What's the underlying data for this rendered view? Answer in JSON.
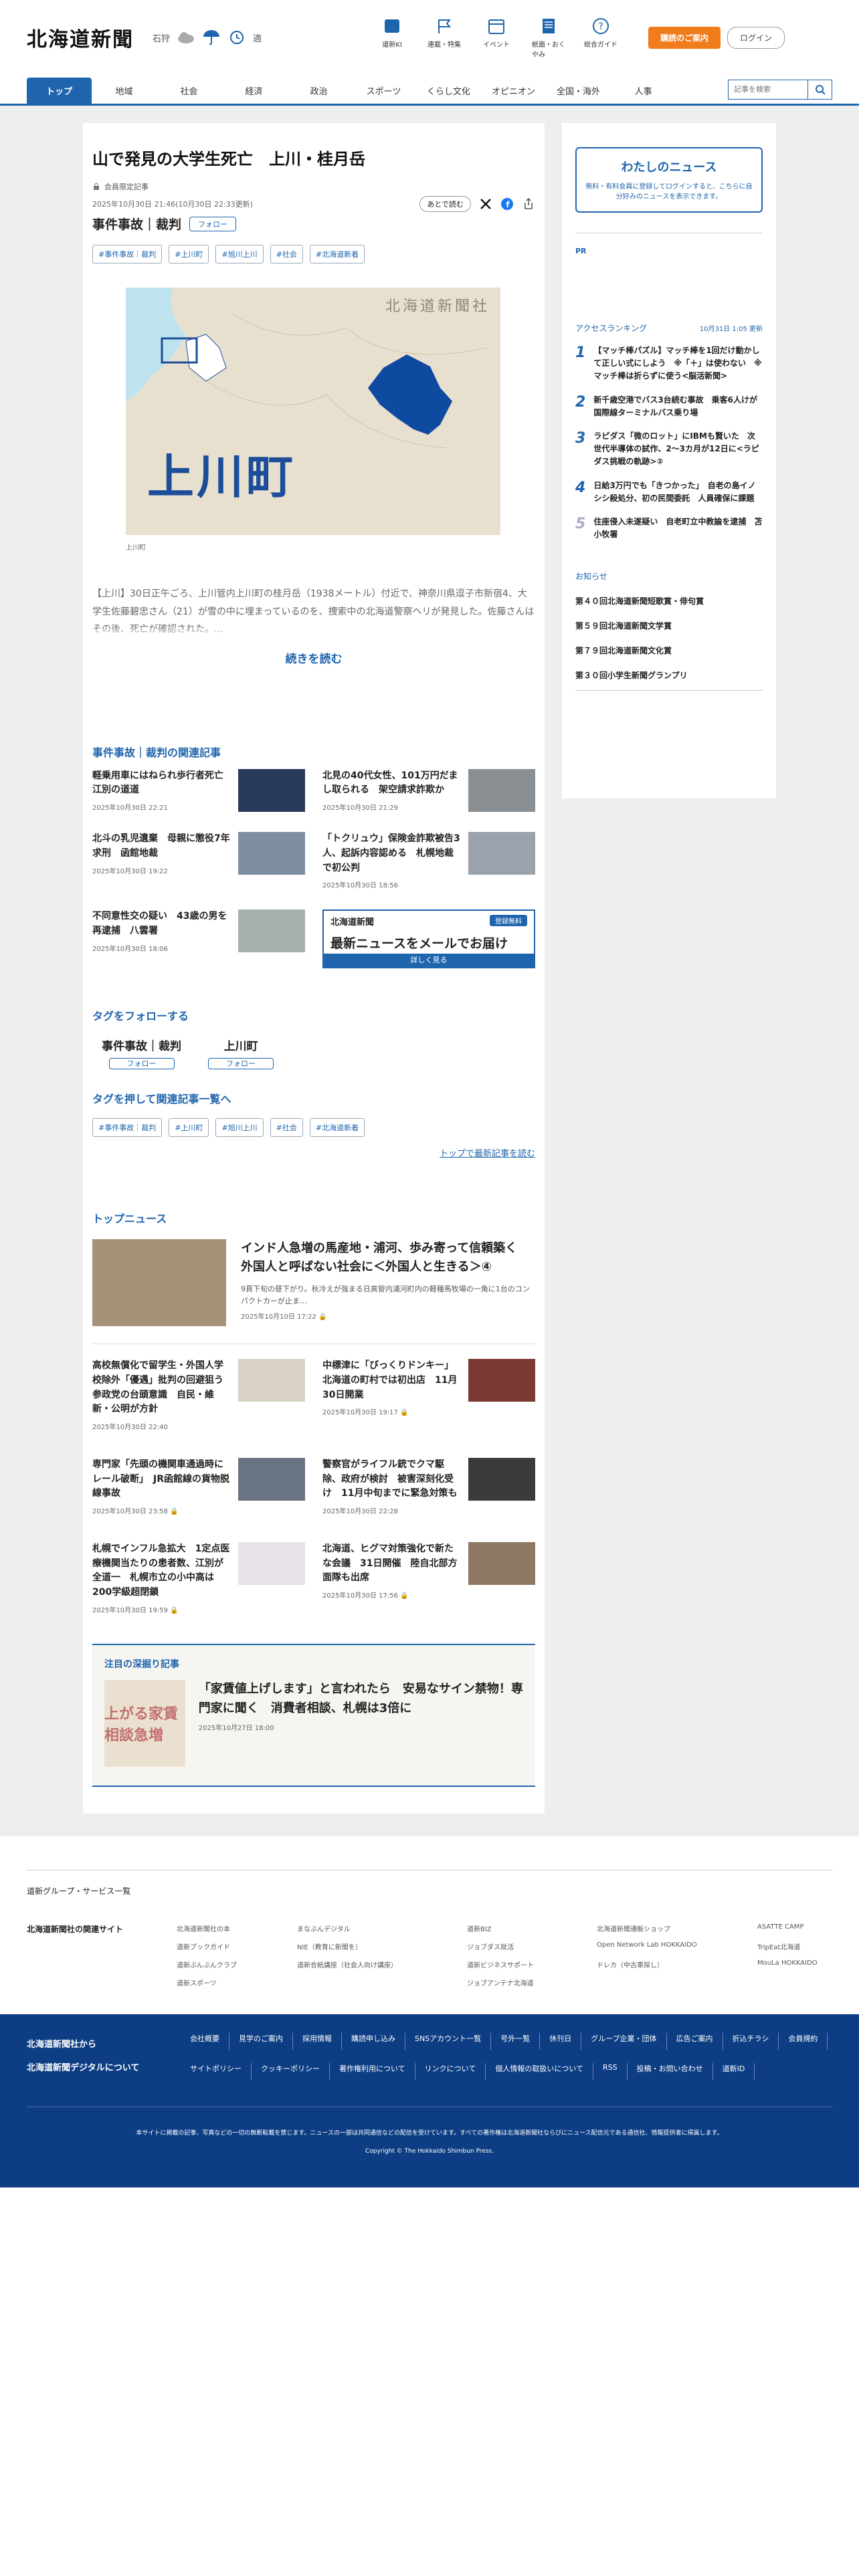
{
  "header": {
    "logo": "北海道新聞",
    "weather_city": "石狩",
    "weather_note": "適",
    "nav": [
      "道新KI",
      "連載・特集",
      "イベント",
      "紙面・おくやみ",
      "総合ガイド"
    ],
    "subscribe": "購読のご案内",
    "login": "ログイン"
  },
  "catnav": {
    "items": [
      "トップ",
      "地域",
      "社会",
      "経済",
      "政治",
      "スポーツ",
      "くらし文化",
      "オピニオン",
      "全国・海外",
      "人事"
    ],
    "search_placeholder": "記事を検索"
  },
  "article": {
    "title": "山で発見の大学生死亡　上川・桂月岳",
    "limited": "会員限定記事",
    "date": "2025年10月30日 21:46(10月30日 22:33更新)",
    "read_later": "あとで読む",
    "category": "事件事故｜裁判",
    "follow": "フォロー",
    "tags": [
      "#事件事故｜裁判",
      "#上川町",
      "#旭川上川",
      "#社会",
      "#北海道新着"
    ],
    "map_watermark": "北海道新聞社",
    "map_label": "上川町",
    "caption": "上川町",
    "lead": "【上川】30日正午ごろ、上川管内上川町の桂月岳（1938メートル）付近で、神奈川県逗子市新宿4、大学生佐藤碧忠さん（21）が雪の中に埋まっているのを、捜索中の北海道警察ヘリが発見した。佐藤さんはその後、死亡が確認された。…",
    "more": "続きを読む"
  },
  "related": {
    "title": "事件事故｜裁判の関連記事",
    "items": [
      {
        "title": "軽乗用車にはねられ歩行者死亡　江別の道道",
        "date": "2025年10月30日 22:21"
      },
      {
        "title": "北見の40代女性、101万円だまし取られる　架空請求詐欺か",
        "date": "2025年10月30日 21:29"
      },
      {
        "title": "北斗の乳児遺棄　母親に懲役7年求刑　函館地裁",
        "date": "2025年10月30日 19:22"
      },
      {
        "title": "「トクリュウ」保険金詐欺被告3人、起訴内容認める　札幌地裁で初公判",
        "date": "2025年10月30日 18:56"
      },
      {
        "title": "不同意性交の疑い　43歳の男を再逮捕　八雲署",
        "date": "2025年10月30日 18:06"
      }
    ],
    "mail": {
      "logo": "北海道新聞",
      "reg": "登録無料",
      "text": "最新ニュースをメールでお届け",
      "btn": "詳しく見る"
    }
  },
  "follow_tags": {
    "title": "タグをフォローする",
    "items": [
      "事件事故｜裁判",
      "上川町"
    ],
    "btn": "フォロー"
  },
  "tag_search": {
    "title": "タグを押して関連記事一覧へ",
    "tags": [
      "#事件事故｜裁判",
      "#上川町",
      "#旭川上川",
      "#社会",
      "#北海道新着"
    ],
    "latest": "トップで最新記事を読む"
  },
  "top_news": {
    "title": "トップニュース",
    "lead_title": "インド人急増の馬産地・浦河、歩み寄って信頼築く　外国人と呼ばない社会に＜外国人と生きる＞④",
    "lead_summary": "9頁下旬の昼下がり。秋冷えが強まる日高管内浦河町内の軽種馬牧場の一角に1台のコンパクトカーが止ま…",
    "lead_date": "2025年10月10日 17:22",
    "items": [
      {
        "title": "高校無償化で留学生・外国人学校除外「優遇」批判の回避狙う　参政党の台頭意識　自民・維新・公明が方針",
        "date": "2025年10月30日 22:40"
      },
      {
        "title": "中標津に「びっくりドンキー」　北海道の町村では初出店　11月30日開業",
        "date": "2025年10月30日 19:17"
      },
      {
        "title": "専門家「先頭の機関車通過時にレール破断」　JR函館線の貨物脱線事故",
        "date": "2025年10月30日 23:58"
      },
      {
        "title": "警察官がライフル銃でクマ駆除、政府が検討　被害深刻化受け　11月中旬までに緊急対策も",
        "date": "2025年10月30日 22:28"
      },
      {
        "title": "札幌でインフル急拡大　1定点医療機関当たりの患者数、江別が全道一　札幌市立の小中高は200学級超閉鎖",
        "date": "2025年10月30日 19:59"
      },
      {
        "title": "北海道、ヒグマ対策強化で新たな会議　31日開催　陸自北部方面隊も出席",
        "date": "2025年10月30日 17:56"
      }
    ]
  },
  "deep": {
    "title": "注目の深掘り記事",
    "img_text": "上がる家賃 相談急増",
    "headline": "「家賃値上げします」と言われたら　安易なサイン禁物！専門家に聞く　消費者相談、札幌は3倍に",
    "date": "2025年10月27日 18:00"
  },
  "sidebar": {
    "mynews_title": "わたしのニュース",
    "mynews_text": "無料・有料会員に登録してログインすると、こちらに自分好みのニュースを表示できます。",
    "pr": "PR",
    "ranking_title": "アクセスランキング",
    "ranking_date": "10月31日 1:05 更新",
    "ranking": [
      "【マッチ棒パズル】マッチ棒を1回だけ動かして正しい式にしよう　※「＋」は使わない　※マッチ棒は折らずに使う<脳活新聞>",
      "新千歳空港でバス3台続む事故　乗客6人けが　国際線ターミナルバス乗り場",
      "ラピダス「微のロット」にIBMも賢いた　次世代半導体の試作、2〜3カ月が12日に<ラピダス挑戦の軌跡>②",
      "日給3万円でも「きつかった」　自老の島イノシシ殺処分、初の民間委託　人員確保に課題",
      "住座侵入未遂疑い　自老町立中教論を逮捕　苫小牧署"
    ],
    "notice_title": "お知らせ",
    "notices": [
      "第４０回北海道新聞短歌賞・俳句賞",
      "第５９回北海道新聞文学賞",
      "第７９回北海道新聞文化賞",
      "第３０回小学生新聞グランプリ"
    ]
  },
  "footer": {
    "group_head": "道新グループ・サービス一覧",
    "related_title": "北海道新聞社の関連サイト",
    "related_links": [
      "北海道新聞社の本",
      "まなぶんデジタル",
      "道新BIZ",
      "北海道新聞通販ショップ",
      "ASATTE CAMP",
      "道新ブックガイド",
      "NIE（教育に新聞を）",
      "ジョブダス就活",
      "Open Network Lab HOKKAIDO",
      "TripEat北海道",
      "道新ぶんぶんクラブ",
      "道新合紙講座（社会人向け講座）",
      "道新ビジネスサポート",
      "ドレカ（中古車探し）",
      "MouLa HOKKAIDO",
      "道新スポーツ",
      "",
      "ジョブアンテナ北海道",
      "",
      ""
    ],
    "blue_titles": [
      "北海道新聞社から",
      "北海道新聞デジタルについて"
    ],
    "blue_links1": [
      "会社概要",
      "見学のご案内",
      "採用情報",
      "購読申し込み",
      "SNSアカウント一覧",
      "号外一覧",
      "休刊日",
      "グループ企業・団体",
      "広告ご案内",
      "折込チラシ"
    ],
    "blue_links2": [
      "会員規約",
      "サイトポリシー",
      "クッキーポリシー",
      "著作権利用について",
      "リンクについて",
      "個人情報の取扱いについて",
      "RSS",
      "投稿・お問い合わせ",
      "道新ID"
    ],
    "disclaimer": "本サイトに掲載の記事、写真などの一切の無断転載を禁じます。ニュースの一部は共同通信などの配信を受けています。すべての著作権は北海道新聞社ならびにニュース配信元である通信社、情報提供者に帰属します。",
    "copyright": "Copyright © The Hokkaido Shimbun Press."
  }
}
